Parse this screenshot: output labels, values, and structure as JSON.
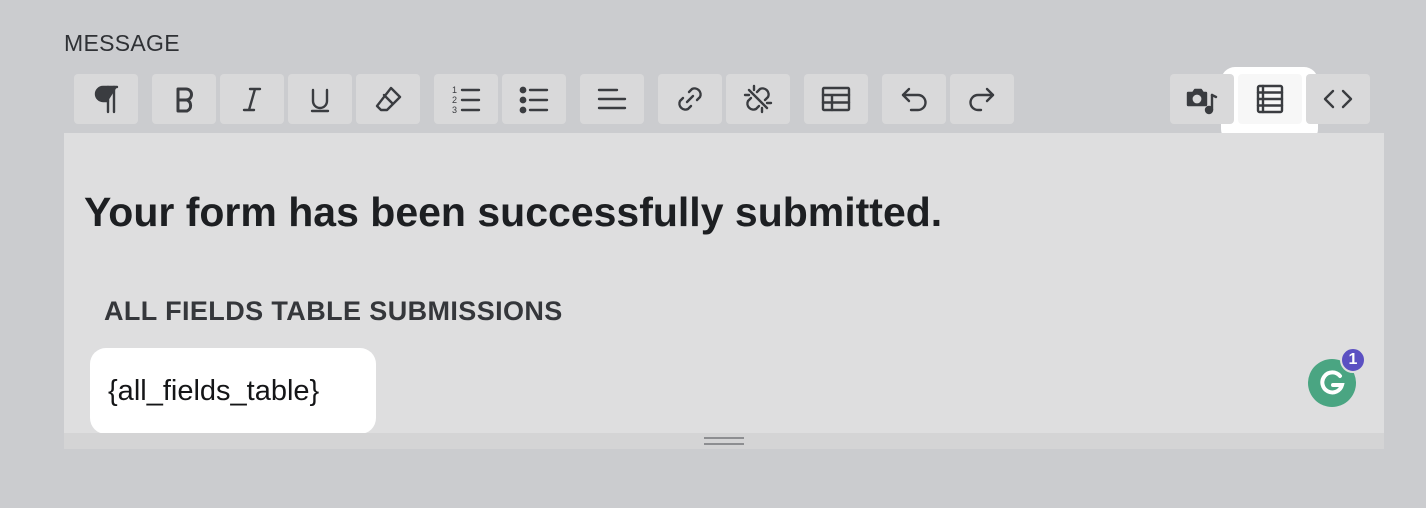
{
  "field": {
    "label": "MESSAGE"
  },
  "toolbar": {
    "buttons": [
      {
        "name": "paragraph-button",
        "icon": "pilcrow-icon"
      },
      {
        "name": "bold-button",
        "icon": "bold-icon"
      },
      {
        "name": "italic-button",
        "icon": "italic-icon"
      },
      {
        "name": "underline-button",
        "icon": "underline-icon"
      },
      {
        "name": "clear-format-button",
        "icon": "eraser-icon"
      },
      {
        "name": "ordered-list-button",
        "icon": "ordered-list-icon"
      },
      {
        "name": "unordered-list-button",
        "icon": "unordered-list-icon"
      },
      {
        "name": "align-left-button",
        "icon": "align-left-icon"
      },
      {
        "name": "insert-link-button",
        "icon": "link-icon"
      },
      {
        "name": "remove-link-button",
        "icon": "unlink-icon"
      },
      {
        "name": "insert-table-button",
        "icon": "table-icon"
      },
      {
        "name": "undo-button",
        "icon": "undo-icon"
      },
      {
        "name": "redo-button",
        "icon": "redo-icon"
      },
      {
        "name": "add-media-button",
        "icon": "media-icon"
      },
      {
        "name": "smart-tags-button",
        "icon": "list-icon",
        "active": true
      },
      {
        "name": "source-code-button",
        "icon": "code-icon"
      }
    ],
    "ordered_list_digits": [
      "1",
      "2",
      "3"
    ]
  },
  "editor": {
    "heading": "Your form has been successfully submitted.",
    "subheading": "ALL FIELDS TABLE SUBMISSIONS",
    "shortcode": "{all_fields_table}"
  },
  "grammarly": {
    "icon": "grammarly-icon",
    "badge_count": "1",
    "color": "#4aa582",
    "badge_color": "#5b50c2"
  }
}
